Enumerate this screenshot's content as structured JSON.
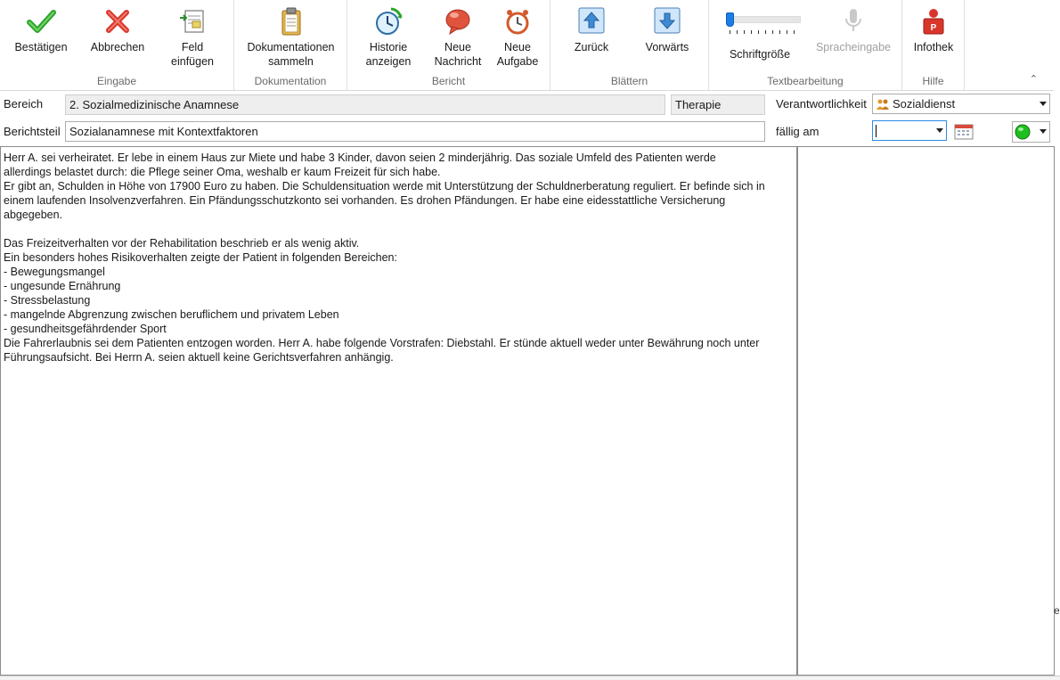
{
  "ribbon": {
    "groups": {
      "eingabe": "Eingabe",
      "dokumentation": "Dokumentation",
      "bericht": "Bericht",
      "blaettern": "Blättern",
      "textbearbeitung": "Textbearbeitung",
      "hilfe": "Hilfe"
    },
    "buttons": {
      "bestaetigen": "Bestätigen",
      "abbrechen": "Abbrechen",
      "feld_einfuegen": "Feld\neinfügen",
      "dokumentationen_sammeln": "Dokumentationen\nsammeln",
      "historie_anzeigen": "Historie\nanzeigen",
      "neue_nachricht": "Neue\nNachricht",
      "neue_aufgabe": "Neue\nAufgabe",
      "zurueck": "Zurück",
      "vorwaerts": "Vorwärts",
      "schriftgroesse": "Schriftgröße",
      "spracheingabe": "Spracheingabe",
      "infothek": "Infothek"
    },
    "collapse_glyph": "⌃"
  },
  "form": {
    "bereich_label": "Bereich",
    "bereich_value": "2. Sozialmedizinische Anamnese",
    "therapie_value": "Therapie",
    "verantwortlichkeit_label": "Verantwortlichkeit",
    "verantwortlichkeit_value": "Sozialdienst",
    "berichtsteil_label": "Berichtsteil",
    "berichtsteil_value": "Sozialanamnese mit Kontextfaktoren",
    "faellig_label": "fällig am",
    "faellig_value": ""
  },
  "editor": {
    "lines": [
      "Herr A. sei verheiratet. Er lebe in einem Haus zur Miete und habe 3 Kinder, davon seien 2 minderjährig. Das soziale Umfeld des Patienten werde",
      "allerdings belastet durch: die Pflege seiner Oma, weshalb er kaum Freizeit für sich habe.",
      "Er gibt an, Schulden in Höhe von 17900 Euro zu haben. Die Schuldensituation werde mit Unterstützung der Schuldnerberatung reguliert. Er befinde sich in",
      "einem laufenden Insolvenzverfahren. Ein Pfändungsschutzkonto sei vorhanden. Es drohen Pfändungen. Er habe eine eidesstattliche Versicherung",
      "abgegeben.",
      "",
      "Das Freizeitverhalten vor der Rehabilitation beschrieb er als wenig aktiv.",
      "Ein besonders hohes Risikoverhalten zeigte der Patient in folgenden Bereichen:",
      "- Bewegungsmangel",
      "- ungesunde Ernährung",
      "- Stressbelastung",
      "- mangelnde Abgrenzung zwischen beruflichem und privatem Leben",
      "- gesundheitsgefährdender Sport",
      "Die Fahrerlaubnis sei dem Patienten entzogen worden. Herr A. habe folgende Vorstrafen: Diebstahl. Er stünde aktuell weder unter Bewährung noch unter",
      "Führungsaufsicht. Bei Herrn A. seien aktuell keine Gerichtsverfahren anhängig."
    ]
  },
  "colors": {
    "status_green": "#1fbf1f",
    "accent_blue": "#1c7de6",
    "cancel_red": "#d9362b",
    "confirm_green": "#2aa52a"
  },
  "icons": {
    "bestaetigen": "checkmark-icon",
    "abbrechen": "cross-icon",
    "feld_einfuegen": "insert-field-icon",
    "dokumentationen_sammeln": "clipboard-icon",
    "historie_anzeigen": "history-clock-icon",
    "neue_nachricht": "message-bubble-icon",
    "neue_aufgabe": "task-alarm-icon",
    "zurueck": "arrow-up-icon",
    "vorwaerts": "arrow-down-icon",
    "spracheingabe": "microphone-icon",
    "infothek": "info-person-icon",
    "verantwortlichkeit": "people-icon",
    "kalender": "calendar-icon",
    "status": "green-status-icon"
  },
  "bottom": {
    "edge_text": "e"
  }
}
